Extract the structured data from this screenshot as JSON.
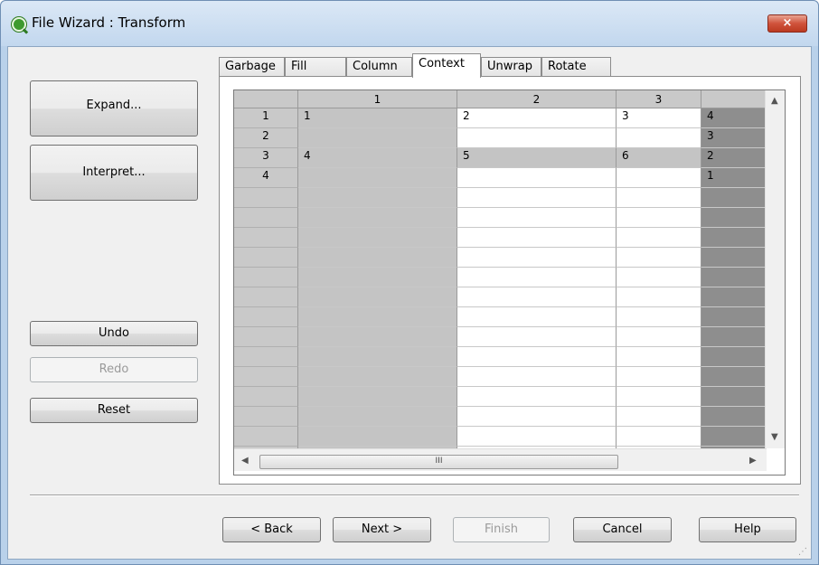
{
  "window": {
    "title": "File Wizard : Transform",
    "close_icon": "×"
  },
  "left_buttons": {
    "expand": "Expand...",
    "interpret": "Interpret...",
    "undo": "Undo",
    "redo": "Redo",
    "reset": "Reset"
  },
  "tabs": [
    "Garbage",
    "Fill",
    "Column",
    "Context",
    "Unwrap",
    "Rotate"
  ],
  "active_tab": "Context",
  "grid": {
    "columns": [
      "1",
      "2",
      "3",
      ""
    ],
    "rows": [
      {
        "label": "1",
        "cells": [
          "1",
          "2",
          "3",
          "4"
        ]
      },
      {
        "label": "2",
        "cells": [
          "",
          "",
          "",
          "3"
        ]
      },
      {
        "label": "3",
        "cells": [
          "4",
          "5",
          "6",
          "2"
        ]
      },
      {
        "label": "4",
        "cells": [
          "",
          "",
          "",
          "1"
        ]
      }
    ],
    "empty_rows": 14,
    "scroll_thumb": "III"
  },
  "footer_buttons": {
    "back": "< Back",
    "next": "Next >",
    "finish": "Finish",
    "cancel": "Cancel",
    "help": "Help"
  },
  "colors": {
    "title_bar": "#c2d7ee",
    "close_button": "#d0533b",
    "selected_column": "#c4c4c4",
    "dark_column": "#8e8e8e"
  }
}
